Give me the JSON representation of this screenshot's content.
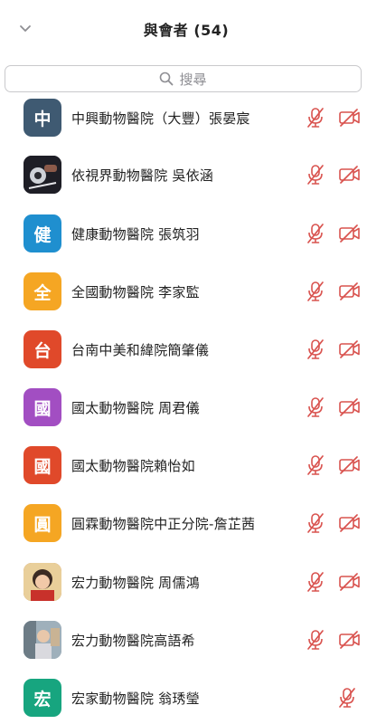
{
  "header": {
    "title": "與會者 (54)"
  },
  "search": {
    "placeholder": "搜尋"
  },
  "colors": {
    "muted_red": "#d9534f"
  },
  "participants": [
    {
      "name": "中興動物醫院（大豐）張晏宸",
      "avatar_char": "中",
      "avatar_color": "#3f5a72",
      "avatar_type": "char",
      "mic": "muted",
      "video": "off"
    },
    {
      "name": "依視界動物醫院 吳依涵",
      "avatar_char": "",
      "avatar_color": "#2b2b35",
      "avatar_type": "photo",
      "mic": "muted",
      "video": "off"
    },
    {
      "name": "健康動物醫院 張筑羽",
      "avatar_char": "健",
      "avatar_color": "#1f8fcf",
      "avatar_type": "char",
      "mic": "muted",
      "video": "off"
    },
    {
      "name": "全國動物醫院 李家監",
      "avatar_char": "全",
      "avatar_color": "#f5a623",
      "avatar_type": "char",
      "mic": "muted",
      "video": "off"
    },
    {
      "name": "台南中美和緯院簡肇儀",
      "avatar_char": "台",
      "avatar_color": "#e0492a",
      "avatar_type": "char",
      "mic": "muted",
      "video": "off"
    },
    {
      "name": "國太動物醫院 周君儀",
      "avatar_char": "國",
      "avatar_color": "#a24ec2",
      "avatar_type": "char",
      "mic": "muted",
      "video": "off"
    },
    {
      "name": "國太動物醫院賴怡如",
      "avatar_char": "國",
      "avatar_color": "#e0492a",
      "avatar_type": "char",
      "mic": "muted",
      "video": "off"
    },
    {
      "name": "圓霖動物醫院中正分院-詹芷茜",
      "avatar_char": "圓",
      "avatar_color": "#f5a623",
      "avatar_type": "char",
      "mic": "muted",
      "video": "off"
    },
    {
      "name": "宏力動物醫院 周儒鴻",
      "avatar_char": "",
      "avatar_color": "#c27a45",
      "avatar_type": "photo",
      "mic": "muted",
      "video": "off"
    },
    {
      "name": "宏力動物醫院高語希",
      "avatar_char": "",
      "avatar_color": "#8a9aa6",
      "avatar_type": "photo",
      "mic": "muted",
      "video": "off"
    },
    {
      "name": "宏家動物醫院 翁琇瑩",
      "avatar_char": "宏",
      "avatar_color": "#17a57f",
      "avatar_type": "char",
      "mic": "muted",
      "video": "none"
    }
  ]
}
